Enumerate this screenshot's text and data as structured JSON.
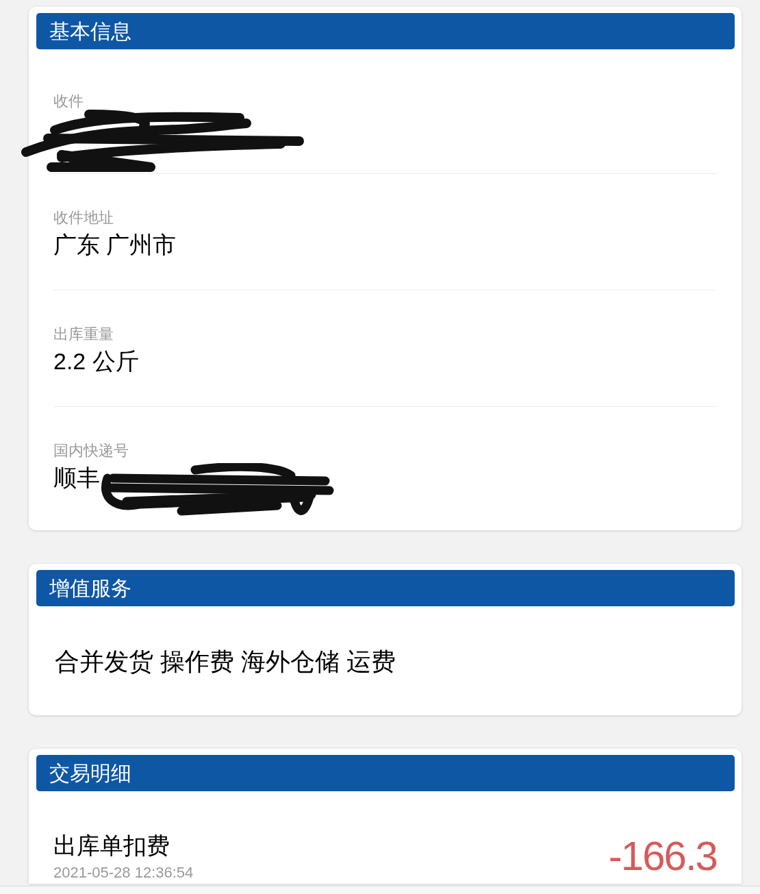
{
  "sections": [
    {
      "kind": "fields",
      "title": "基本信息",
      "fields": [
        {
          "label": "收件",
          "redacted": true
        },
        {
          "label": "收件地址",
          "value": "广东 广州市",
          "redacted": false
        },
        {
          "label": "出库重量",
          "value": "2.2 公斤",
          "redacted": false
        },
        {
          "label": "国内快递号",
          "value": "顺丰",
          "redacted": true
        }
      ]
    },
    {
      "kind": "text",
      "title": "增值服务",
      "text": "合并发货 操作费 海外仓储 运费"
    },
    {
      "kind": "transactions",
      "title": "交易明细",
      "rows": [
        {
          "name": "出库单扣费",
          "time": "2021-05-28 12:36:54",
          "amount": "-166.3"
        }
      ]
    }
  ]
}
